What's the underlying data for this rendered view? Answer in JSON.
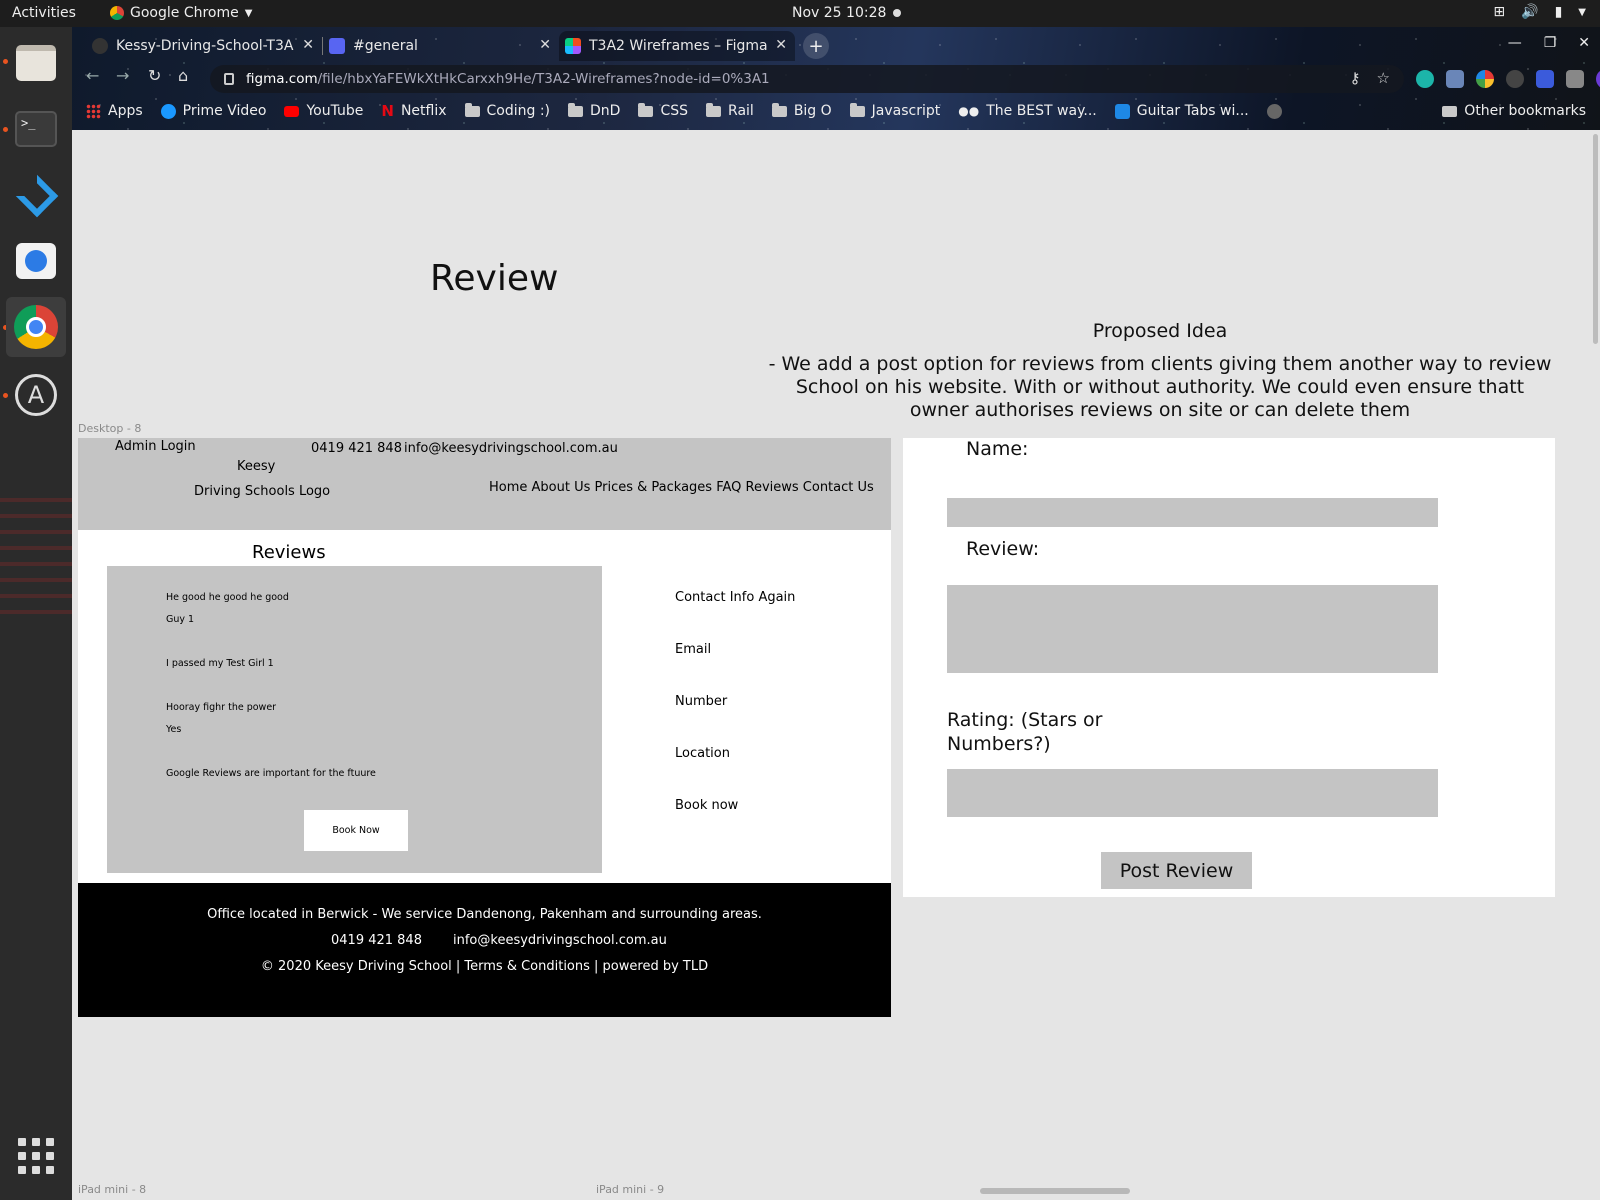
{
  "system": {
    "activities": "Activities",
    "app_name": "Google Chrome",
    "clock": "Nov 25  10:28"
  },
  "browser": {
    "tabs": [
      {
        "title": "Kessy-Driving-School-T3A",
        "favicon": "github-icon"
      },
      {
        "title": "#general",
        "favicon": "discord-icon"
      },
      {
        "title": "T3A2 Wireframes – Figma",
        "favicon": "figma-icon",
        "active": true
      }
    ],
    "url_host": "figma.com",
    "url_path": "/file/hbxYaFEWkXtHkCarxxh9He/T3A2-Wireframes?node-id=0%3A1",
    "profile_initial": "A",
    "bookmarks": [
      {
        "label": "Apps",
        "icon": "apps-grid-icon"
      },
      {
        "label": "Prime Video",
        "icon": "prime-video-icon"
      },
      {
        "label": "YouTube",
        "icon": "youtube-icon"
      },
      {
        "label": "Netflix",
        "icon": "netflix-icon"
      },
      {
        "label": "Coding :)",
        "icon": "folder-icon"
      },
      {
        "label": "DnD",
        "icon": "folder-icon"
      },
      {
        "label": "CSS",
        "icon": "folder-icon"
      },
      {
        "label": "Rail",
        "icon": "folder-icon"
      },
      {
        "label": "Big O",
        "icon": "folder-icon"
      },
      {
        "label": "Javascript",
        "icon": "folder-icon"
      },
      {
        "label": "The BEST way...",
        "icon": "medium-icon"
      },
      {
        "label": "Guitar Tabs wi...",
        "icon": "guitar-tabs-icon"
      },
      {
        "label": "",
        "icon": "circle-icon"
      }
    ],
    "other_bookmarks": "Other bookmarks"
  },
  "canvas": {
    "page_title": "Review",
    "proposed_title": "Proposed Idea",
    "proposed_text": "- We add a post option for reviews from clients giving them another way to review School on his website. With or without authority. We could even ensure thatt owner authorises reviews on site or can delete them",
    "frame_labels": {
      "desktop": "Desktop - 8",
      "ipad8": "iPad mini - 8",
      "ipad9": "iPad mini - 9"
    }
  },
  "wireframe": {
    "header": {
      "admin_login": "Admin Login",
      "logo_line1": "Keesy",
      "logo_line2": "Driving Schools Logo",
      "phone": "0419 421 848",
      "email": "info@keesydrivingschool.com.au",
      "nav": "Home About Us Prices & Packages FAQ Reviews Contact Us"
    },
    "reviews_heading": "Reviews",
    "reviews": [
      "He good he good he good",
      "Guy 1",
      "I passed my Test Girl 1",
      "Hooray fighr the power",
      "Yes",
      "Google Reviews are important for the ftuure"
    ],
    "book_button": "Book Now",
    "contact": [
      "Contact Info Again",
      "Email",
      "Number",
      "Location",
      "Book now"
    ],
    "footer": {
      "office": "Office located in Berwick - We service Dandenong, Pakenham and surrounding areas.",
      "phone": "0419 421 848",
      "email": "info@keesydrivingschool.com.au",
      "copyright": "© 2020 Keesy Driving School | Terms & Conditions | powered by TLD"
    }
  },
  "form": {
    "name_label": "Name:",
    "review_label": "Review:",
    "rating_label_line1": "Rating: (Stars or",
    "rating_label_line2": "Numbers?)",
    "post_button": "Post Review"
  }
}
